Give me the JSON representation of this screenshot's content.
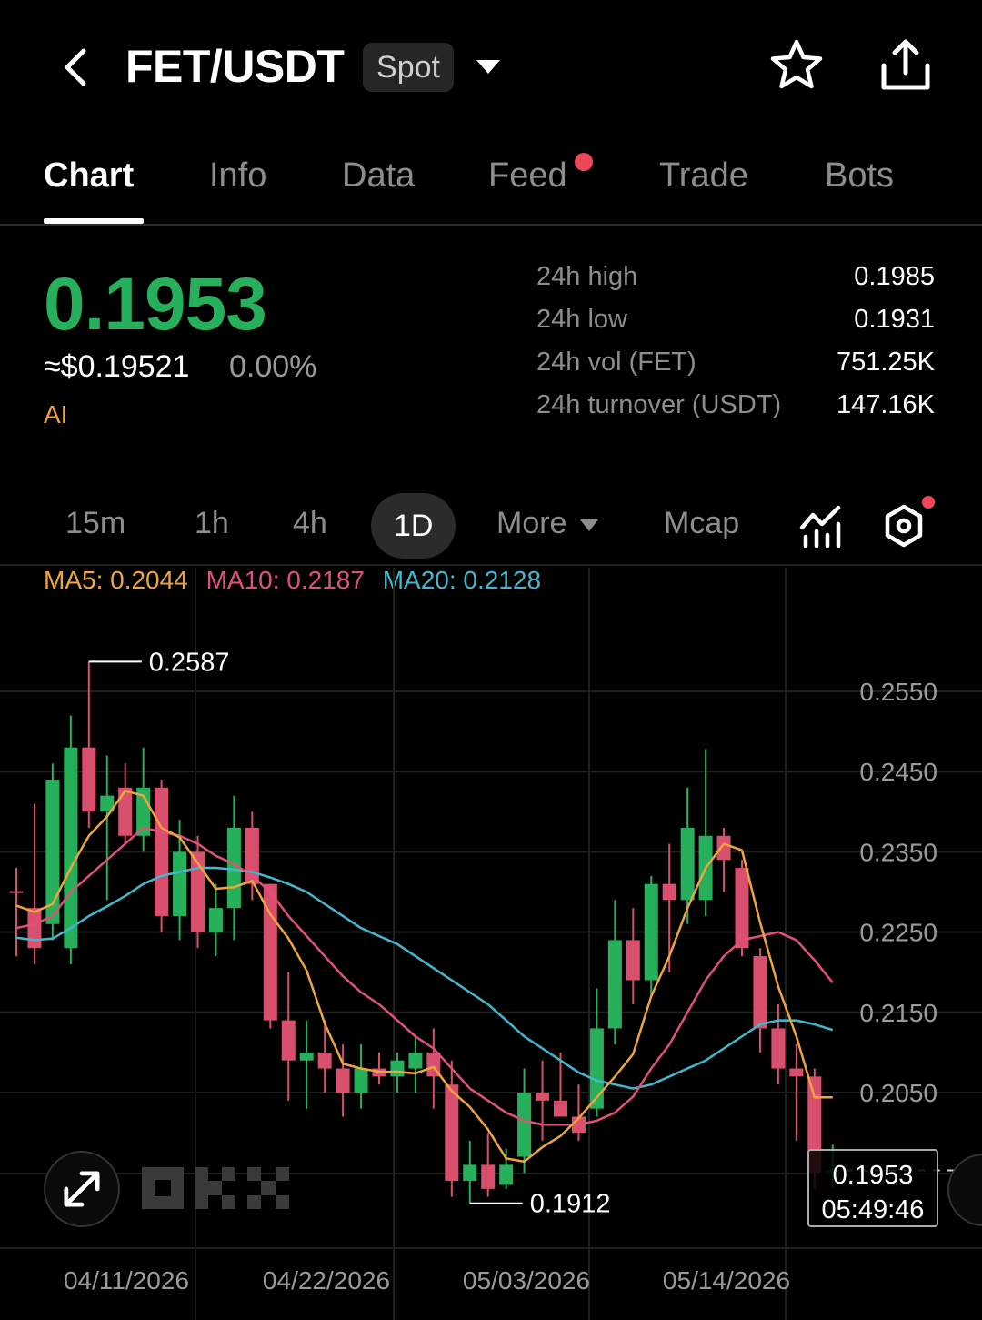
{
  "header": {
    "pair": "FET/USDT",
    "market_type": "Spot",
    "icons": [
      "back-icon",
      "chevron-down-icon",
      "star-icon",
      "share-icon"
    ]
  },
  "tabs": [
    {
      "label": "Chart",
      "active": true
    },
    {
      "label": "Info",
      "active": false
    },
    {
      "label": "Data",
      "active": false
    },
    {
      "label": "Feed",
      "active": false,
      "has_dot": true
    },
    {
      "label": "Trade",
      "active": false
    },
    {
      "label": "Bots",
      "active": false
    }
  ],
  "ticker": {
    "price": "0.1953",
    "usd_price": "≈$0.19521",
    "change": "0.00%",
    "tag": "AI",
    "price_color": "#27b05b"
  },
  "stats": [
    {
      "label": "24h high",
      "value": "0.1985"
    },
    {
      "label": "24h low",
      "value": "0.1931"
    },
    {
      "label": "24h vol (FET)",
      "value": "751.25K"
    },
    {
      "label": "24h turnover (USDT)",
      "value": "147.16K"
    }
  ],
  "toolbar": {
    "timeframes": [
      "15m",
      "1h",
      "4h",
      "1D"
    ],
    "active_timeframe": "1D",
    "more_label": "More",
    "mcap_label": "Mcap"
  },
  "indicators": {
    "ma5": "MA5: 0.2044",
    "ma10": "MA10: 0.2187",
    "ma20": "MA20: 0.2128"
  },
  "chart_data": {
    "type": "candlestick",
    "y_ticks": [
      "0.2550",
      "0.2450",
      "0.2350",
      "0.2250",
      "0.2150",
      "0.2050"
    ],
    "x_ticks": [
      "04/11/2026",
      "04/22/2026",
      "05/03/2026",
      "05/14/2026"
    ],
    "max_label": "0.2587",
    "min_label": "0.1912",
    "ylim": [
      0.185,
      0.264
    ],
    "grid": true,
    "colors": {
      "up": "#27b05b",
      "down": "#d94f6e",
      "ma5": "#f0a53c",
      "ma10": "#e0507a",
      "ma20": "#42b8d0"
    },
    "candles": [
      {
        "o": 0.2301,
        "h": 0.233,
        "l": 0.222,
        "c": 0.23
      },
      {
        "o": 0.228,
        "h": 0.241,
        "l": 0.221,
        "c": 0.223
      },
      {
        "o": 0.226,
        "h": 0.246,
        "l": 0.224,
        "c": 0.244
      },
      {
        "o": 0.223,
        "h": 0.252,
        "l": 0.221,
        "c": 0.248
      },
      {
        "o": 0.248,
        "h": 0.2587,
        "l": 0.238,
        "c": 0.24
      },
      {
        "o": 0.24,
        "h": 0.247,
        "l": 0.229,
        "c": 0.242
      },
      {
        "o": 0.243,
        "h": 0.246,
        "l": 0.236,
        "c": 0.237
      },
      {
        "o": 0.237,
        "h": 0.248,
        "l": 0.235,
        "c": 0.243
      },
      {
        "o": 0.243,
        "h": 0.244,
        "l": 0.225,
        "c": 0.227
      },
      {
        "o": 0.227,
        "h": 0.239,
        "l": 0.224,
        "c": 0.235
      },
      {
        "o": 0.235,
        "h": 0.237,
        "l": 0.223,
        "c": 0.225
      },
      {
        "o": 0.225,
        "h": 0.231,
        "l": 0.222,
        "c": 0.228
      },
      {
        "o": 0.228,
        "h": 0.242,
        "l": 0.224,
        "c": 0.238
      },
      {
        "o": 0.238,
        "h": 0.24,
        "l": 0.229,
        "c": 0.231
      },
      {
        "o": 0.231,
        "h": 0.231,
        "l": 0.213,
        "c": 0.214
      },
      {
        "o": 0.214,
        "h": 0.22,
        "l": 0.204,
        "c": 0.209
      },
      {
        "o": 0.209,
        "h": 0.214,
        "l": 0.203,
        "c": 0.21
      },
      {
        "o": 0.21,
        "h": 0.214,
        "l": 0.205,
        "c": 0.208
      },
      {
        "o": 0.208,
        "h": 0.211,
        "l": 0.202,
        "c": 0.205
      },
      {
        "o": 0.205,
        "h": 0.211,
        "l": 0.203,
        "c": 0.208
      },
      {
        "o": 0.208,
        "h": 0.21,
        "l": 0.206,
        "c": 0.207
      },
      {
        "o": 0.207,
        "h": 0.21,
        "l": 0.205,
        "c": 0.209
      },
      {
        "o": 0.208,
        "h": 0.212,
        "l": 0.205,
        "c": 0.21
      },
      {
        "o": 0.21,
        "h": 0.213,
        "l": 0.203,
        "c": 0.207
      },
      {
        "o": 0.206,
        "h": 0.209,
        "l": 0.192,
        "c": 0.194
      },
      {
        "o": 0.194,
        "h": 0.199,
        "l": 0.1912,
        "c": 0.196
      },
      {
        "o": 0.196,
        "h": 0.2,
        "l": 0.192,
        "c": 0.193
      },
      {
        "o": 0.1935,
        "h": 0.198,
        "l": 0.193,
        "c": 0.196
      },
      {
        "o": 0.197,
        "h": 0.208,
        "l": 0.195,
        "c": 0.205
      },
      {
        "o": 0.205,
        "h": 0.209,
        "l": 0.199,
        "c": 0.204
      },
      {
        "o": 0.204,
        "h": 0.21,
        "l": 0.202,
        "c": 0.202
      },
      {
        "o": 0.202,
        "h": 0.206,
        "l": 0.199,
        "c": 0.2
      },
      {
        "o": 0.203,
        "h": 0.218,
        "l": 0.202,
        "c": 0.213
      },
      {
        "o": 0.213,
        "h": 0.229,
        "l": 0.211,
        "c": 0.224
      },
      {
        "o": 0.224,
        "h": 0.228,
        "l": 0.216,
        "c": 0.219
      },
      {
        "o": 0.219,
        "h": 0.232,
        "l": 0.217,
        "c": 0.231
      },
      {
        "o": 0.231,
        "h": 0.236,
        "l": 0.22,
        "c": 0.229
      },
      {
        "o": 0.229,
        "h": 0.243,
        "l": 0.226,
        "c": 0.238
      },
      {
        "o": 0.229,
        "h": 0.2478,
        "l": 0.227,
        "c": 0.237
      },
      {
        "o": 0.237,
        "h": 0.238,
        "l": 0.23,
        "c": 0.234
      },
      {
        "o": 0.233,
        "h": 0.234,
        "l": 0.222,
        "c": 0.223
      },
      {
        "o": 0.222,
        "h": 0.223,
        "l": 0.21,
        "c": 0.213
      },
      {
        "o": 0.213,
        "h": 0.216,
        "l": 0.206,
        "c": 0.208
      },
      {
        "o": 0.208,
        "h": 0.211,
        "l": 0.199,
        "c": 0.207
      },
      {
        "o": 0.207,
        "h": 0.208,
        "l": 0.193,
        "c": 0.195
      },
      {
        "o": 0.1953,
        "h": 0.1985,
        "l": 0.1931,
        "c": 0.1953
      }
    ],
    "ma5": [
      0.2283,
      0.2275,
      0.2285,
      0.233,
      0.237,
      0.2394,
      0.2426,
      0.242,
      0.238,
      0.2368,
      0.2336,
      0.2304,
      0.2306,
      0.2314,
      0.2272,
      0.2242,
      0.2202,
      0.2136,
      0.2086,
      0.208,
      0.2076,
      0.2076,
      0.2074,
      0.2082,
      0.2052,
      0.2032,
      0.2004,
      0.1968,
      0.1964,
      0.1982,
      0.1996,
      0.2018,
      0.2044,
      0.207,
      0.2098,
      0.217,
      0.222,
      0.228,
      0.233,
      0.236,
      0.2352,
      0.2262,
      0.2182,
      0.212,
      0.2044,
      0.2044
    ],
    "ma10": [
      0.2255,
      0.226,
      0.227,
      0.23,
      0.232,
      0.234,
      0.236,
      0.238,
      0.2375,
      0.237,
      0.236,
      0.2345,
      0.2335,
      0.232,
      0.23,
      0.227,
      0.2245,
      0.222,
      0.2195,
      0.2175,
      0.216,
      0.214,
      0.212,
      0.2105,
      0.208,
      0.2055,
      0.204,
      0.2025,
      0.2015,
      0.201,
      0.201,
      0.201,
      0.2015,
      0.2025,
      0.2045,
      0.208,
      0.211,
      0.215,
      0.219,
      0.222,
      0.224,
      0.2245,
      0.225,
      0.224,
      0.2215,
      0.2187
    ],
    "ma20": [
      0.2243,
      0.224,
      0.2242,
      0.2255,
      0.227,
      0.2282,
      0.2295,
      0.231,
      0.232,
      0.2325,
      0.233,
      0.233,
      0.2328,
      0.2325,
      0.2318,
      0.231,
      0.23,
      0.2285,
      0.227,
      0.2255,
      0.2245,
      0.2235,
      0.222,
      0.2205,
      0.219,
      0.2175,
      0.216,
      0.214,
      0.212,
      0.2105,
      0.209,
      0.2075,
      0.2065,
      0.206,
      0.2055,
      0.206,
      0.207,
      0.208,
      0.209,
      0.2105,
      0.212,
      0.2135,
      0.214,
      0.214,
      0.2135,
      0.2128
    ]
  },
  "price_tag": {
    "price": "0.1953",
    "countdown": "05:49:46"
  },
  "controls": {
    "fullscreen_icon": "expand-icon",
    "watermark": "OKX"
  }
}
